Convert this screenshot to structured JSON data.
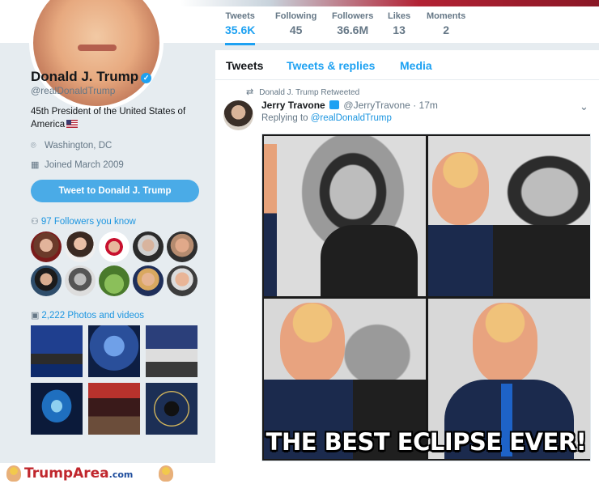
{
  "nav": {
    "stats": [
      {
        "label": "Tweets",
        "value": "35.6K"
      },
      {
        "label": "Following",
        "value": "45"
      },
      {
        "label": "Followers",
        "value": "36.6M"
      },
      {
        "label": "Likes",
        "value": "13"
      },
      {
        "label": "Moments",
        "value": "2"
      }
    ]
  },
  "profile": {
    "name": "Donald J. Trump",
    "verified_icon": "✓",
    "handle": "@realDonaldTrump",
    "bio": "45th President of the United States of America",
    "location": "Washington, DC",
    "joined": "Joined March 2009",
    "tweet_to_label": "Tweet to Donald J. Trump",
    "followers_you_know": "97 Followers you know",
    "photos_videos": "2,222 Photos and videos"
  },
  "tabs": [
    "Tweets",
    "Tweets & replies",
    "Media"
  ],
  "tweet": {
    "retweet_line": "Donald J. Trump Retweeted",
    "author_name": "Jerry Travone",
    "author_handle": "@JerryTravone",
    "time": "· 17m",
    "replying_prefix": "Replying to",
    "replying_to": "@realDonaldTrump",
    "image_caption": "THE BEST ECLIPSE EVER!"
  },
  "footer": {
    "brand": "TrumpArea",
    "domain": ".com"
  },
  "colors": {
    "accent": "#1da1f2",
    "button": "#4aabe7",
    "brand_red": "#c0272d",
    "brand_blue": "#1c4b9c"
  },
  "icons": {
    "location": "location-pin-icon",
    "calendar": "calendar-icon",
    "people": "person-icon",
    "photos": "image-icon",
    "retweet": "retweet-icon",
    "chevron": "chevron-down-icon"
  }
}
